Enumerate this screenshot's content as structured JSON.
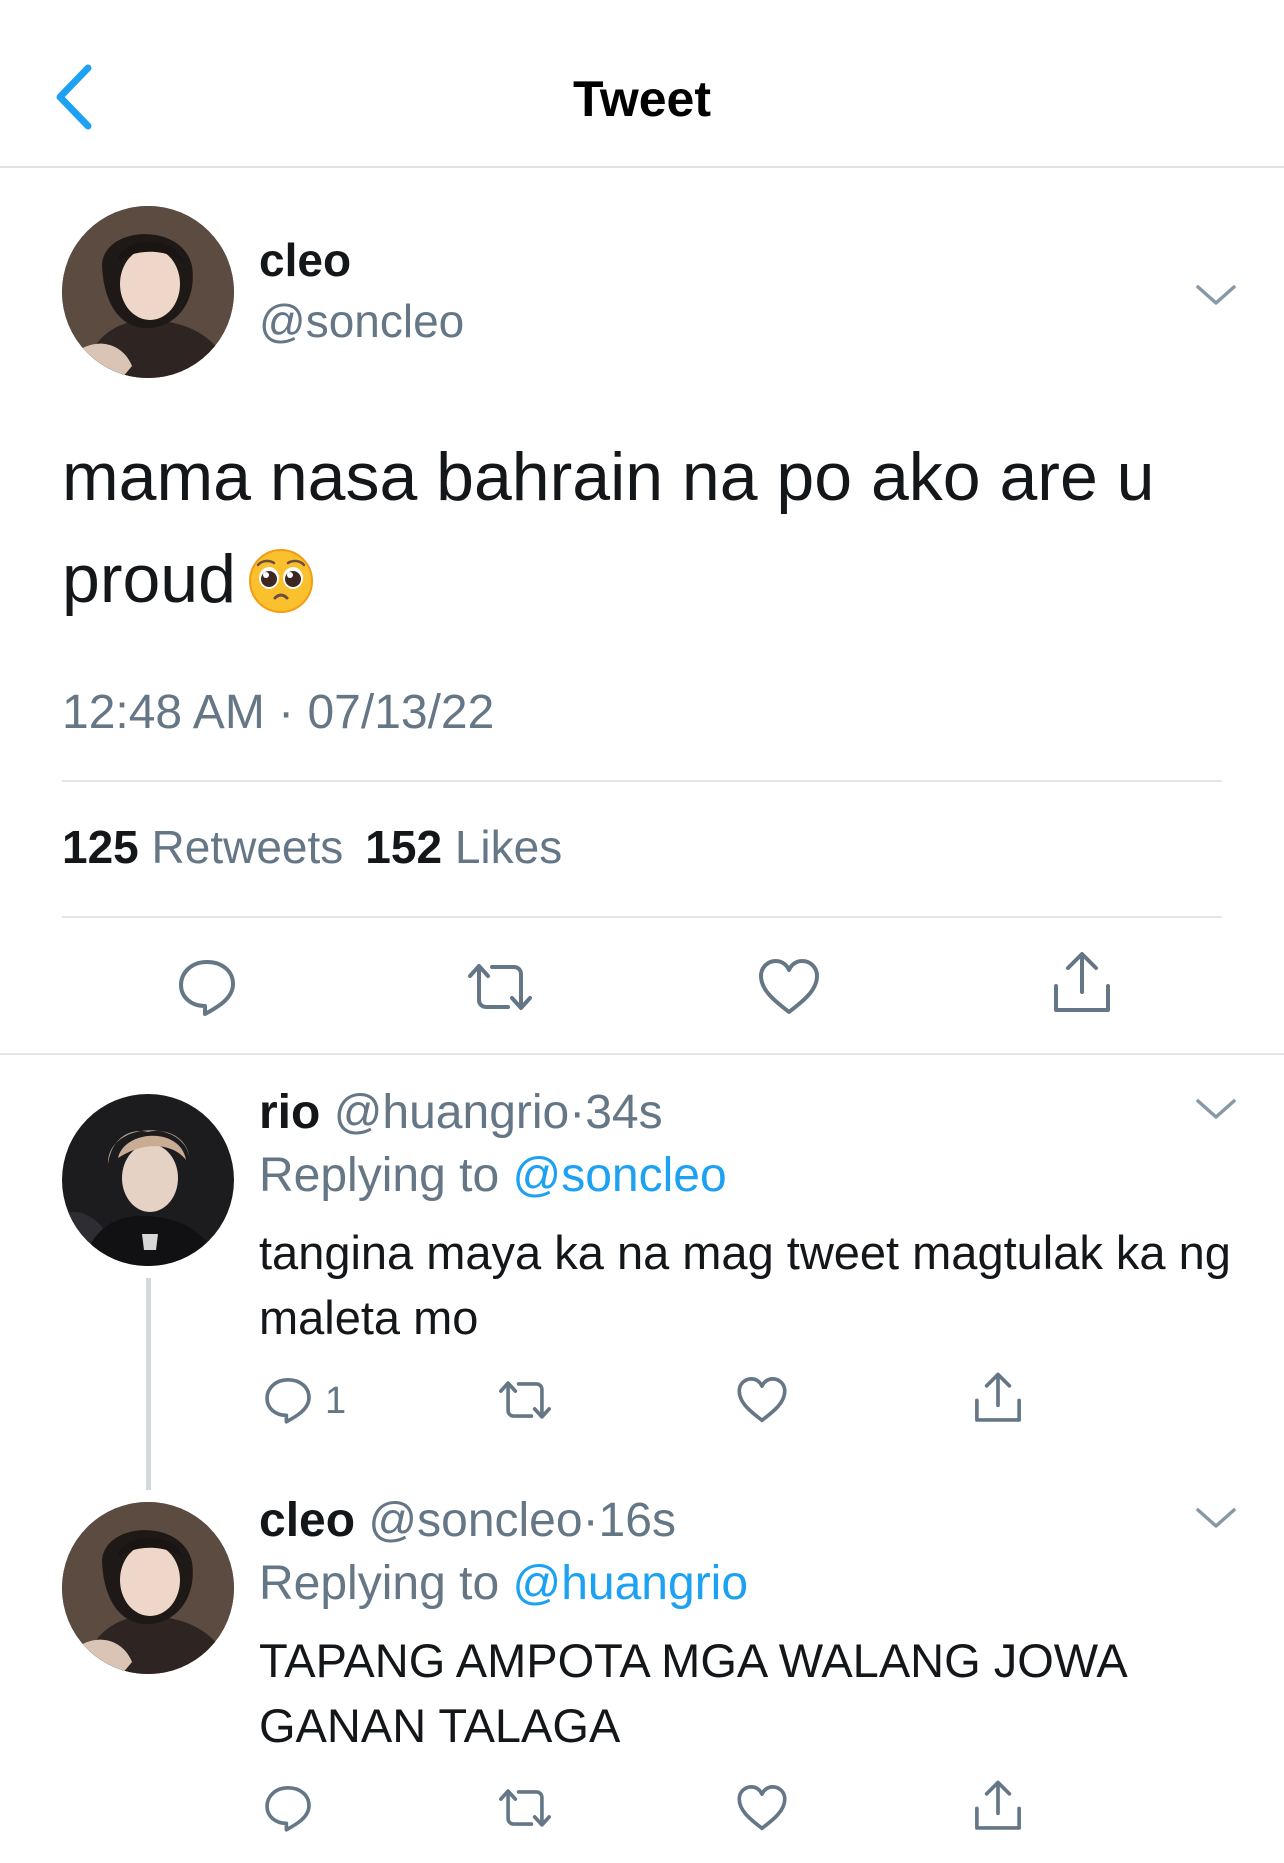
{
  "header": {
    "title": "Tweet",
    "back_icon": "chevron-left-icon",
    "accent_color": "#1da1f2"
  },
  "main_tweet": {
    "display_name": "cleo",
    "handle": "@soncleo",
    "text": "mama nasa bahrain na po ako are u proud",
    "emoji": "pleading-face-emoji",
    "timestamp": "12:48 AM · 07/13/22",
    "retweet_count": "125",
    "retweet_label": "Retweets",
    "like_count": "152",
    "like_label": "Likes",
    "actions": [
      "reply-icon",
      "retweet-icon",
      "like-icon",
      "share-icon"
    ]
  },
  "replies": [
    {
      "display_name": "rio",
      "handle": "@huangrio",
      "separator": "·",
      "time": "34s",
      "replying_prefix": "Replying to",
      "replying_to": "@soncleo",
      "text": "tangina maya ka na mag tweet magtulak ka ng maleta mo",
      "reply_count": "1"
    },
    {
      "display_name": "cleo",
      "handle": "@soncleo",
      "separator": "·",
      "time": "16s",
      "replying_prefix": "Replying to",
      "replying_to": "@huangrio",
      "text": "TAPANG AMPOTA MGA WALANG JOWA GANAN TALAGA"
    }
  ]
}
